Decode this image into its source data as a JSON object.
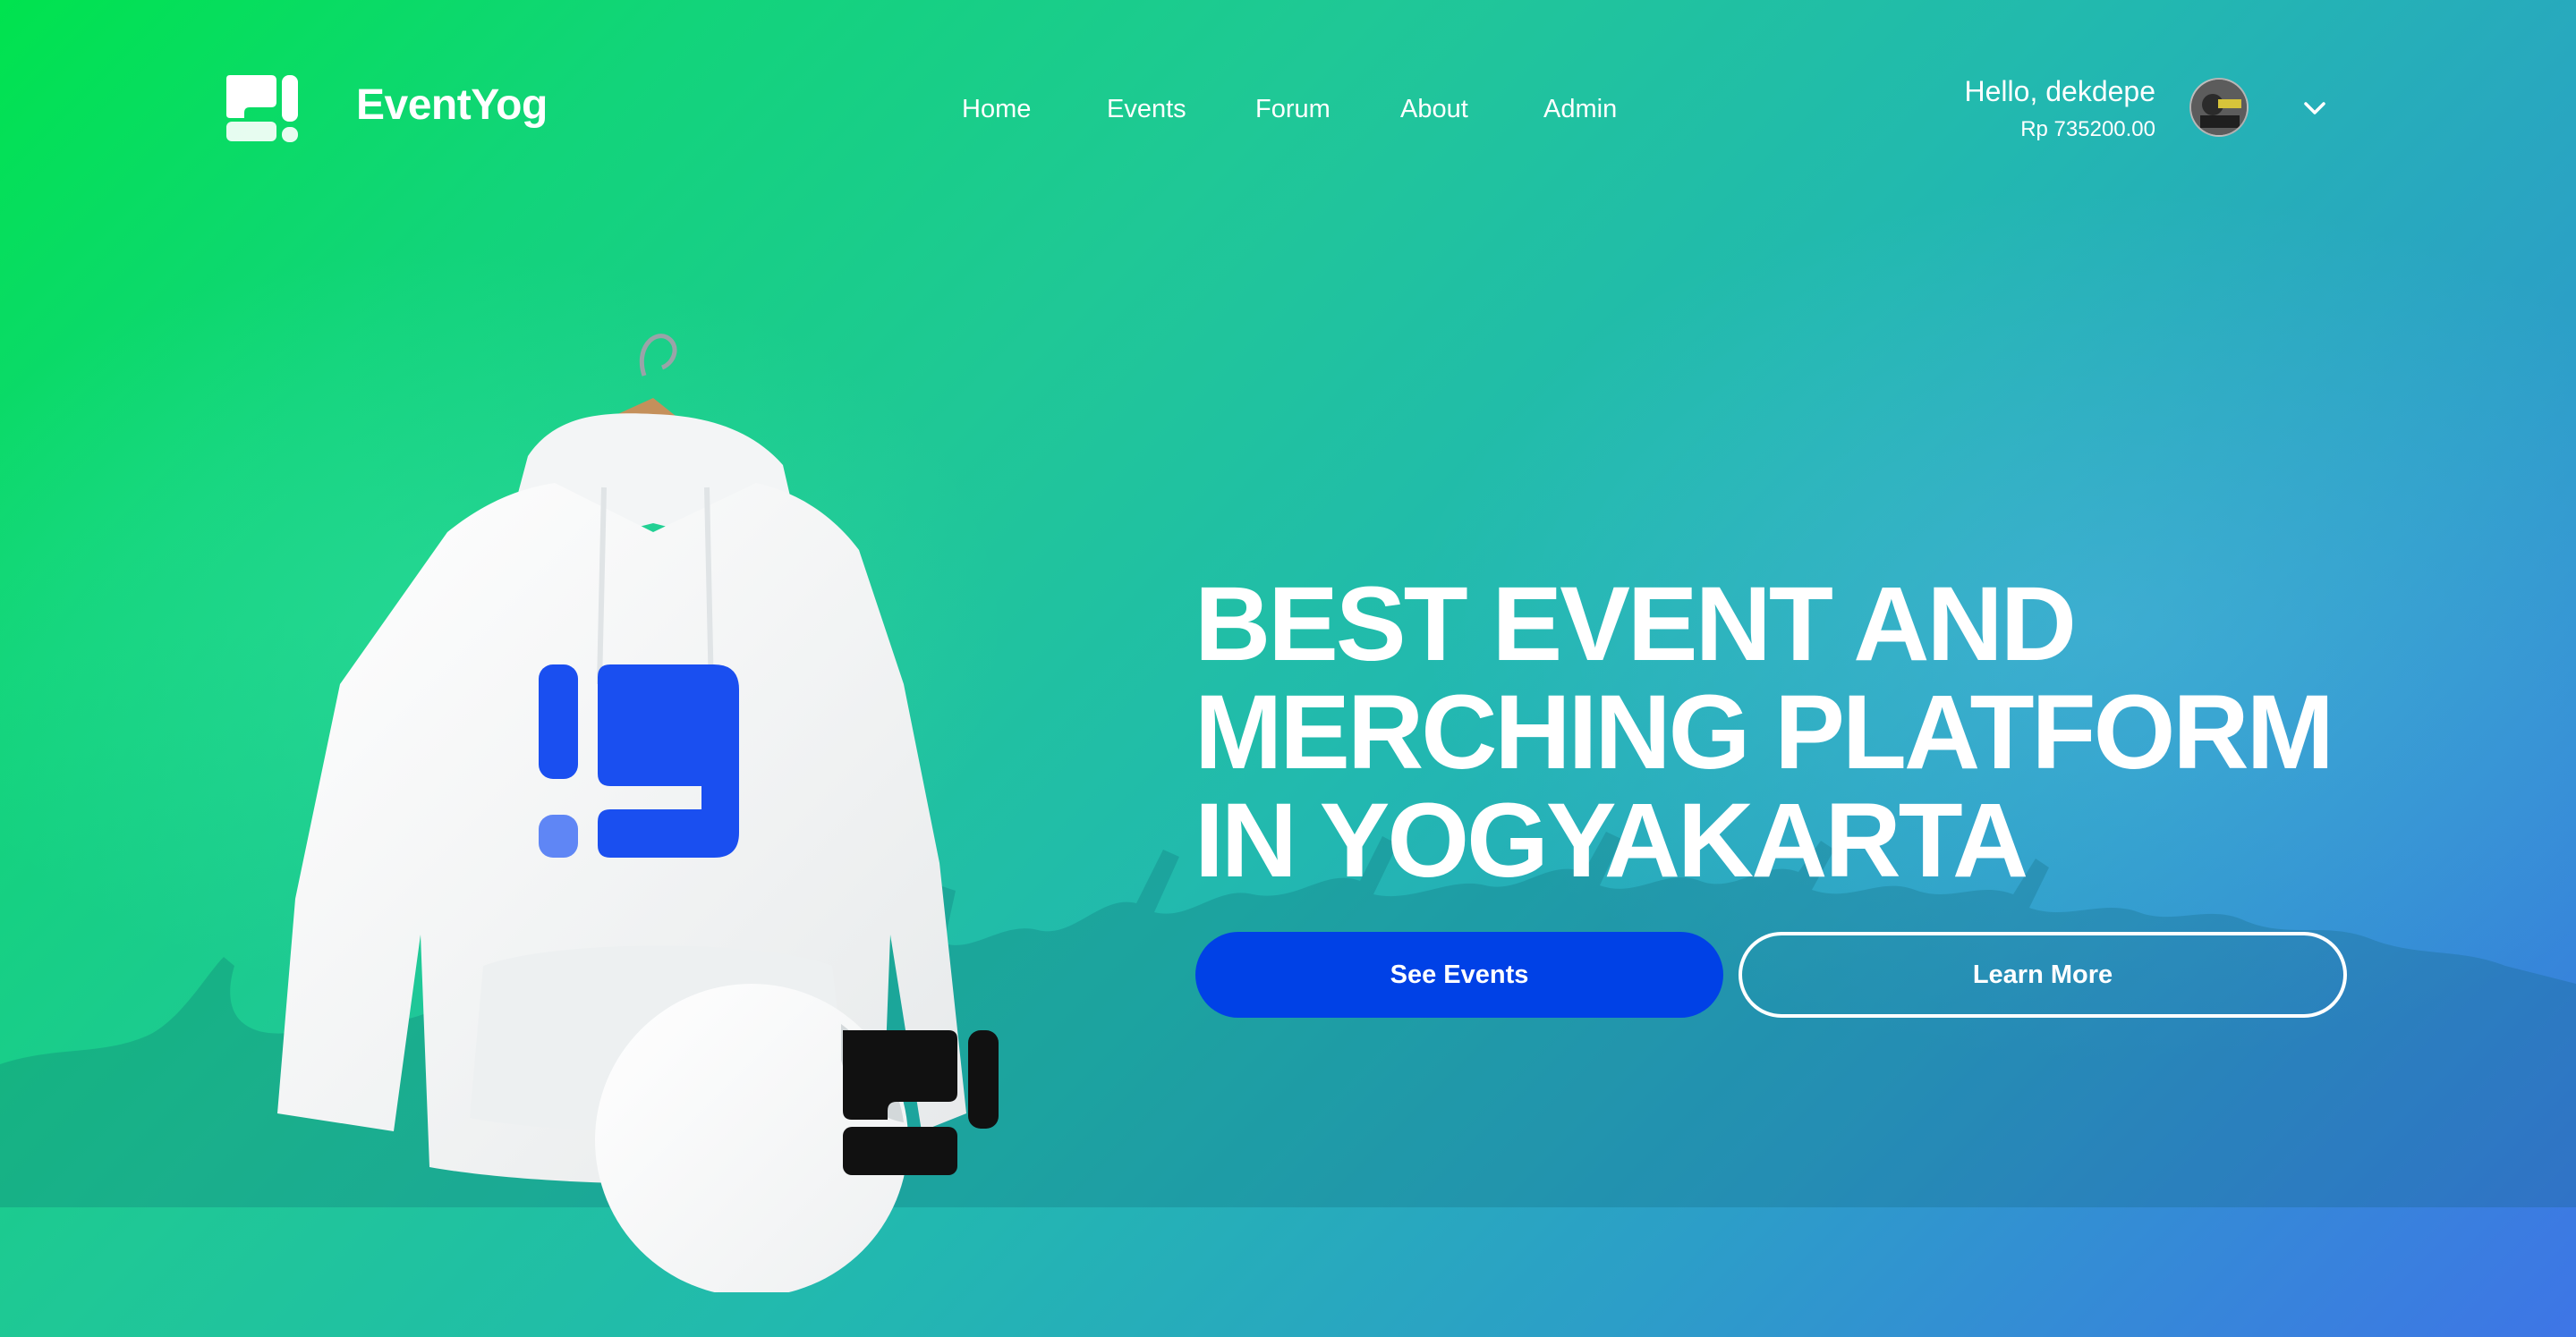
{
  "brand": {
    "name": "EventYog",
    "logo_icon": "eventyog-logo-icon"
  },
  "nav": {
    "links": [
      "Home",
      "Events",
      "Forum",
      "About",
      "Admin"
    ]
  },
  "user": {
    "greeting": "Hello, dekdepe",
    "balance": "Rp 735200.00",
    "avatar_icon": "user-avatar",
    "menu_icon": "chevron-down-icon"
  },
  "hero": {
    "headline": [
      "BEST EVENT AND",
      "MERCHING PLATFORM",
      "IN YOGYAKARTA"
    ],
    "primary_button": "See Events",
    "secondary_button": "Learn More",
    "image": "hoodie-merch-image"
  },
  "colors": {
    "gradient_start": "#00e34e",
    "gradient_end": "#3e75e6",
    "primary_button": "#0041e6",
    "logo_blue": "#1a4ff0",
    "text": "#ffffff"
  }
}
